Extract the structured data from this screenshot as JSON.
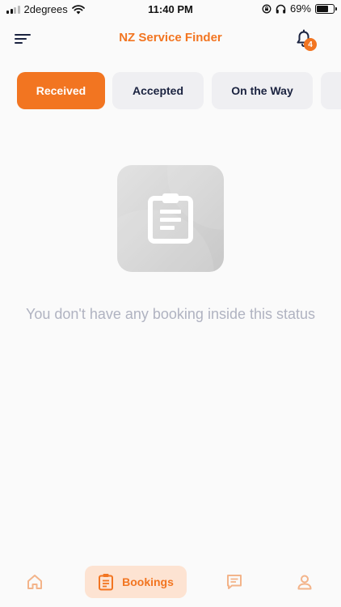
{
  "status_bar": {
    "carrier": "2degrees",
    "time": "11:40 PM",
    "battery_percent": "69%",
    "battery_level": 0.69
  },
  "header": {
    "title": "NZ Service Finder",
    "notification_count": "4"
  },
  "tabs": [
    {
      "label": "Received",
      "active": true
    },
    {
      "label": "Accepted",
      "active": false
    },
    {
      "label": "On the Way",
      "active": false
    }
  ],
  "empty_state": {
    "message": "You don't have any booking inside this status"
  },
  "bottom_nav": {
    "bookings_label": "Bookings"
  },
  "colors": {
    "accent": "#f27521",
    "accent_light": "#fde3d2",
    "nav_inactive": "#f3b48a",
    "text_dark": "#1b2340",
    "muted_text": "#b0b3c1"
  }
}
